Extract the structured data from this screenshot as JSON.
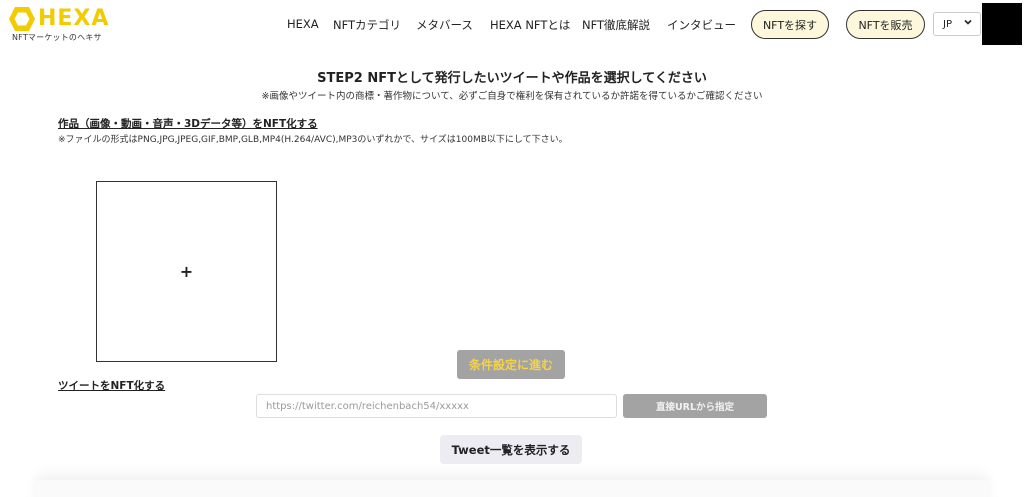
{
  "header": {
    "logo_text": "HEXA",
    "logo_sub": "NFTマーケットのヘキサ",
    "logo_icon": "hexagon-ring-icon",
    "nav": [
      {
        "label": "HEXA"
      },
      {
        "label": "NFTカテゴリ"
      },
      {
        "label": "メタバース"
      },
      {
        "label": "HEXA NFTとは"
      },
      {
        "label": "NFT徹底解説"
      },
      {
        "label": "インタビュー"
      }
    ],
    "find_button": "NFTを探す",
    "sell_button": "NFTを販売",
    "language": "JP",
    "language_icon": "chevron-down-icon"
  },
  "main": {
    "title": "STEP2 NFTとして発行したいツイートや作品を選択してください",
    "note": "※画像やツイート内の商標・著作物について、必ずご自身で権利を保有されているか許諾を得ているかご確認ください",
    "artwork_section": {
      "label": "作品（画像・動画・音声・3Dデータ等）をNFT化する",
      "file_note": "※ファイルの形式はPNG,JPG,JPEG,GIF,BMP,GLB,MP4(H.264/AVC),MP3のいずれかで、サイズは100MB以下にして下さい。",
      "upload_symbol": "+"
    },
    "proceed_button": "条件設定に進む",
    "tweet_section": {
      "label": "ツイートをNFT化する",
      "url_placeholder": "https://twitter.com/reichenbach54/xxxxx",
      "url_value": "",
      "direct_button": "直接URLから指定",
      "list_button": "Tweet一覧を表示する"
    }
  },
  "colors": {
    "brand_yellow": "#f2cb00",
    "pill_bg": "#fdf7dc",
    "disabled_gray": "#a3a3a3",
    "proceed_text": "#f4d24a"
  }
}
